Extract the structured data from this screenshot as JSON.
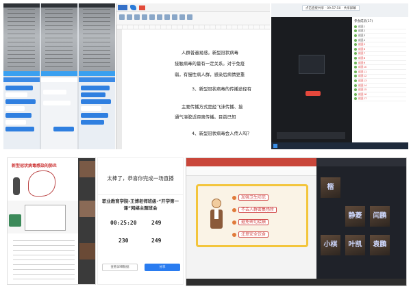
{
  "panel_doc": {
    "lines": [
      "人群普遍易感。新型冠状病毒",
      "接触病毒的量有一定关系。对于免疫",
      "弱，有慢性病人群，感染后病情更重",
      "3、新型冠状病毒的传播途径有",
      "主要传播方式是经飞沫传播、接",
      "通气溶胶近距离传播。目前已知",
      "4、新型冠状病毒会人传人吗？"
    ]
  },
  "panel_meeting": {
    "hint": "点击直接共享 · 09:57:50 · 共享屏幕",
    "list_title": "参会成员(17)",
    "participants": [
      "成员1",
      "成员2",
      "成员3",
      "成员4",
      "成员5",
      "成员6",
      "成员7",
      "成员8",
      "成员9",
      "成员10",
      "成员11",
      "成员12",
      "成员13",
      "成员14",
      "成员15",
      "成员16",
      "成员17"
    ]
  },
  "panel_completion": {
    "heading": "太棒了，恭喜你完成一场直播",
    "subtitle_line1": "职业教育学院-王博老师班级-“开学第一",
    "subtitle_line2": "课”网络主题班会",
    "stats": [
      {
        "value": "00:25:20"
      },
      {
        "value": "249"
      },
      {
        "value": "230"
      },
      {
        "value": "249"
      }
    ],
    "buttons": {
      "left": "查看详细数据",
      "right": "分享"
    }
  },
  "panel_slide": {
    "items": [
      "加强卫生防范",
      "不去人群密集场所",
      "避免密切接触",
      "注意安全饮食"
    ],
    "tile_names": [
      "楷",
      "静菱",
      "小棋",
      "叶凯",
      "闫鹏",
      "袁鹏"
    ]
  },
  "panel_mobile": {
    "card_title": "新型冠状病毒感染的肺炎"
  }
}
